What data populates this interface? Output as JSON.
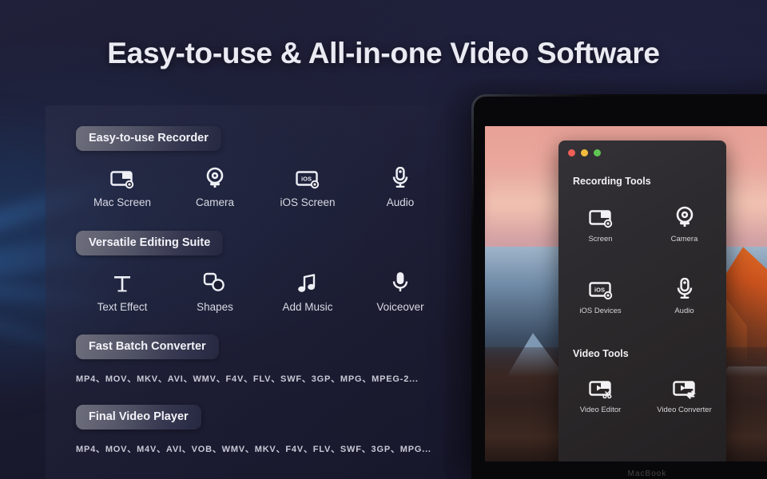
{
  "page_title": "Easy-to-use & All-in-one Video Software",
  "colors": {
    "background": "#1c1c31",
    "panel": "#2e2f49",
    "pill_light": "#6d6e7c",
    "pill_dark": "#262841",
    "title_text": "#e9eaf2",
    "caption_text": "#d9dae4",
    "traffic_close": "#ef5f56",
    "traffic_min": "#f3bc3f",
    "traffic_max": "#60c554"
  },
  "features": [
    {
      "id": "recorder",
      "pill": "Easy-to-use Recorder",
      "items": [
        {
          "label": "Mac Screen",
          "icon": "screen-record-icon"
        },
        {
          "label": "Camera",
          "icon": "camera-icon"
        },
        {
          "label": "iOS Screen",
          "icon": "ios-screen-icon"
        },
        {
          "label": "Audio",
          "icon": "microphone-icon"
        }
      ]
    },
    {
      "id": "editing",
      "pill": "Versatile Editing Suite",
      "items": [
        {
          "label": "Text Effect",
          "icon": "text-icon"
        },
        {
          "label": "Shapes",
          "icon": "shapes-icon"
        },
        {
          "label": "Add Music",
          "icon": "music-note-icon"
        },
        {
          "label": "Voiceover",
          "icon": "microphone-icon"
        }
      ]
    },
    {
      "id": "converter",
      "pill": "Fast Batch Converter",
      "formats": "MP4、MOV、MKV、AVI、WMV、F4V、FLV、SWF、3GP、MPG、MPEG-2..."
    },
    {
      "id": "player",
      "pill": "Final Video Player",
      "formats": "MP4、MOV、M4V、AVI、VOB、WMV、MKV、F4V、FLV、SWF、3GP、MPG..."
    }
  ],
  "app_window": {
    "traffic_lights": [
      "close",
      "minimize",
      "maximize"
    ],
    "sections": [
      {
        "heading": "Recording Tools",
        "items": [
          {
            "label": "Screen",
            "icon": "screen-record-icon"
          },
          {
            "label": "Camera",
            "icon": "camera-icon"
          },
          {
            "label": "iOS Devices",
            "icon": "ios-screen-icon"
          },
          {
            "label": "Audio",
            "icon": "microphone-icon"
          }
        ]
      },
      {
        "heading": "Video Tools",
        "items": [
          {
            "label": "Video Editor",
            "icon": "video-edit-icon"
          },
          {
            "label": "Video Converter",
            "icon": "video-convert-icon"
          }
        ]
      }
    ]
  },
  "device": {
    "wordmark": "MacBook"
  }
}
